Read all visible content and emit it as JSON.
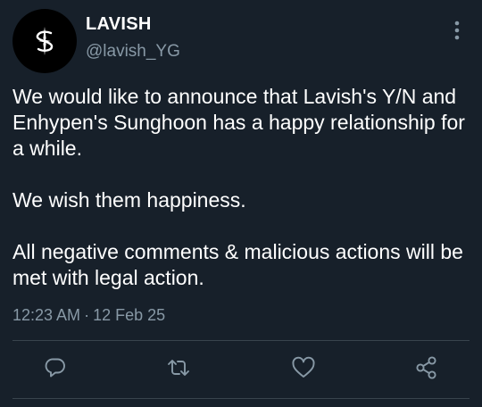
{
  "account": {
    "display_name": "LAVISH",
    "handle": "@lavish_YG",
    "avatar_icon": "sparkle-logo"
  },
  "tweet": {
    "paragraphs": [
      "We would like to announce that Lavish's Y/N and Enhypen's Sunghoon has a happy relationship for a while.",
      "We wish them happiness.",
      "All negative comments & malicious actions will be met with legal action."
    ],
    "time": "12:23 AM",
    "separator": "·",
    "date": "12 Feb 25"
  },
  "actions": [
    {
      "icon": "reply-icon"
    },
    {
      "icon": "retweet-icon"
    },
    {
      "icon": "like-icon"
    },
    {
      "icon": "share-icon"
    }
  ],
  "colors": {
    "background": "#17202a",
    "text": "#ffffff",
    "muted": "#8899a6",
    "divider": "#38444d"
  }
}
